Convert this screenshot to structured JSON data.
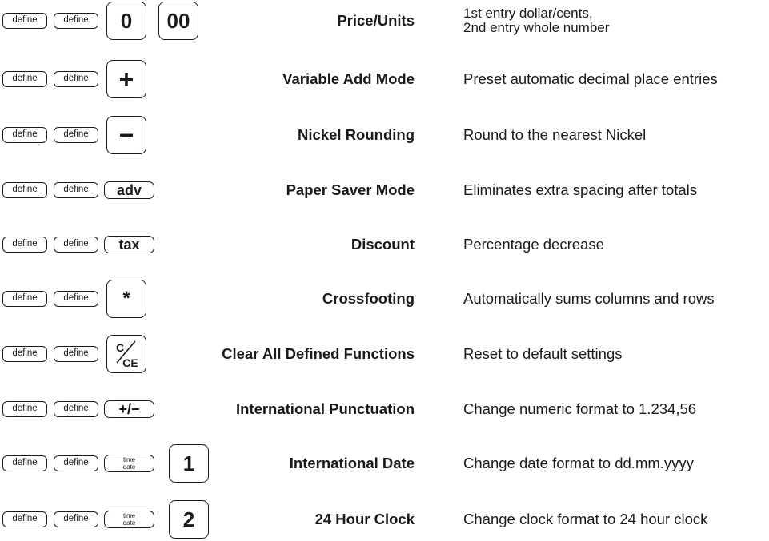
{
  "define_label": "define",
  "rows": [
    {
      "title": "Price/Units",
      "description_line1": "1st entry dollar/cents,",
      "description_line2": "2nd entry whole number",
      "keys": [
        {
          "label": "0",
          "icon": "zero-key"
        },
        {
          "label": "00",
          "icon": "double-zero-key"
        }
      ]
    },
    {
      "title": "Variable Add Mode",
      "description": "Preset automatic decimal place entries",
      "key": {
        "label": "+",
        "icon": "plus-key"
      }
    },
    {
      "title": "Nickel Rounding",
      "description": "Round to the nearest Nickel",
      "key": {
        "label": "−",
        "icon": "minus-key"
      }
    },
    {
      "title": "Paper Saver Mode",
      "description": "Eliminates extra spacing after totals",
      "key": {
        "label": "adv"
      }
    },
    {
      "title": "Discount",
      "description": "Percentage decrease",
      "key": {
        "label": "tax"
      }
    },
    {
      "title": "Crossfooting",
      "description": "Automatically sums columns and rows",
      "key": {
        "label": "*",
        "icon": "asterisk-key"
      }
    },
    {
      "title": "Clear All Defined Functions",
      "description": "Reset to default settings",
      "key": {
        "label_top": "C",
        "label_bottom": "CE",
        "icon": "clear-entry-key"
      }
    },
    {
      "title": "International Punctuation",
      "description": "Change numeric format to 1.234,56",
      "key": {
        "label": "+/−",
        "icon": "plus-minus-key"
      }
    },
    {
      "title": "International Date",
      "description": "Change date format to dd.mm.yyyy",
      "time_key": {
        "top": "time",
        "bottom": "date"
      },
      "key": {
        "label": "1"
      }
    },
    {
      "title": "24 Hour Clock",
      "description": "Change clock format to 24 hour clock",
      "time_key": {
        "top": "time",
        "bottom": "date"
      },
      "key": {
        "label": "2"
      }
    }
  ]
}
